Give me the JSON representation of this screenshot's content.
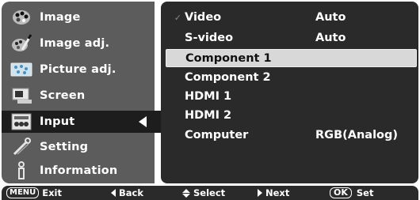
{
  "sidebar": {
    "items": [
      {
        "label": "Image",
        "icon": "palette-icon"
      },
      {
        "label": "Image adj.",
        "icon": "paint-palette-brush-icon"
      },
      {
        "label": "Picture adj.",
        "icon": "picture-screen-icon"
      },
      {
        "label": "Screen",
        "icon": "screen-icon"
      },
      {
        "label": "Input",
        "icon": "input-cables-icon",
        "selected": true
      },
      {
        "label": "Setting",
        "icon": "wrench-icon"
      },
      {
        "label": "Information",
        "icon": "information-icon"
      }
    ]
  },
  "input_list": {
    "rows": [
      {
        "label": "Video",
        "value": "Auto",
        "checked": true
      },
      {
        "label": "S-video",
        "value": "Auto"
      },
      {
        "label": "Component 1",
        "value": "",
        "highlighted": true
      },
      {
        "label": "Component 2",
        "value": ""
      },
      {
        "label": "HDMI 1",
        "value": ""
      },
      {
        "label": "HDMI 2",
        "value": ""
      },
      {
        "label": "Computer",
        "value": "RGB(Analog)"
      }
    ],
    "check_glyph": "✓"
  },
  "footer": {
    "menu_key": "MENU",
    "exit_label": "Exit",
    "back_label": "Back",
    "select_label": "Select",
    "next_label": "Next",
    "ok_key": "OK",
    "set_label": "Set"
  },
  "colors": {
    "sidebar_bg": "#5c5c5c",
    "selected_bg": "#1d1d1d",
    "content_bg": "#2a2a2a",
    "highlight_bg": "#d8d8d8"
  }
}
